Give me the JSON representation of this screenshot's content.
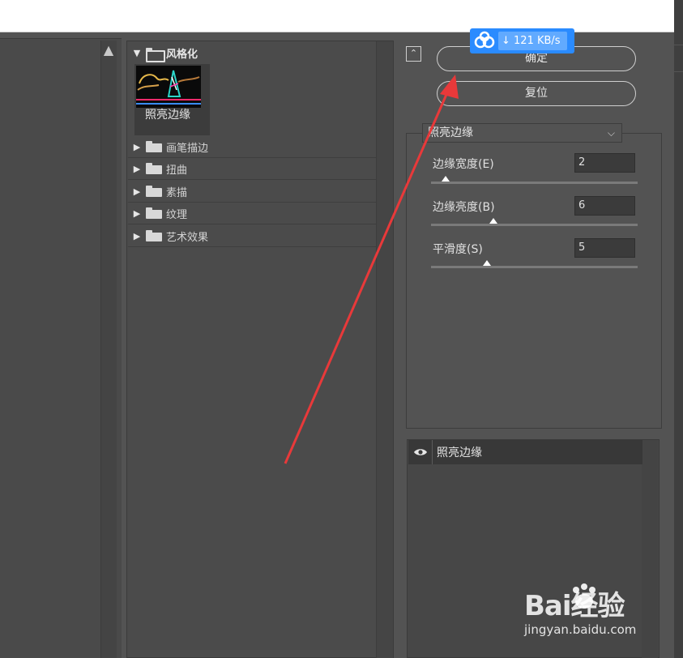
{
  "gallery": {
    "expanded_folder": "风格化",
    "selected_filter_thumb": "照亮边缘",
    "folders": [
      "画笔描边",
      "扭曲",
      "素描",
      "纹理",
      "艺术效果"
    ]
  },
  "buttons": {
    "ok": "确定",
    "reset": "复位"
  },
  "download_badge": {
    "speed": "121 KB/s",
    "icon": "baidu-netdisk-icon"
  },
  "filter_select": {
    "value": "照亮边缘"
  },
  "params": [
    {
      "label": "边缘宽度(E)",
      "value": "2",
      "fraction": 0.07
    },
    {
      "label": "边缘亮度(B)",
      "value": "6",
      "fraction": 0.3
    },
    {
      "label": "平滑度(S)",
      "value": "5",
      "fraction": 0.27
    }
  ],
  "layers": {
    "items": [
      {
        "name": "照亮边缘",
        "visible": true
      }
    ]
  },
  "watermark": {
    "brand": "Bai经验",
    "url": "jingyan.baidu.com"
  },
  "colors": {
    "arrow": "#e8393a",
    "badge": "#2a8bff",
    "panel": "#535353"
  }
}
